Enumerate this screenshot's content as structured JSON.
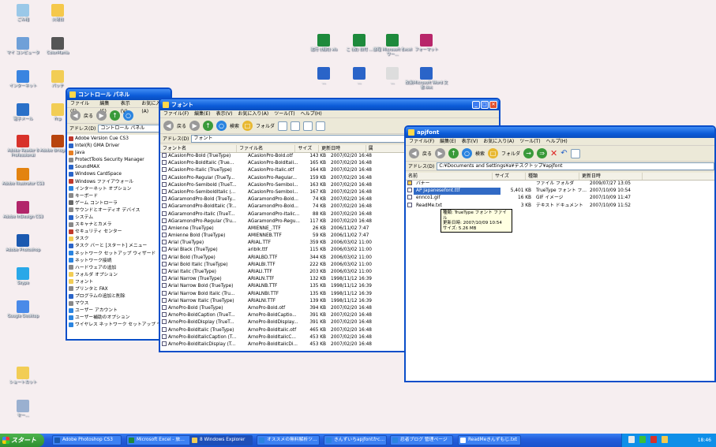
{
  "desktop_icons": [
    {
      "label": "ごみ箱",
      "color": "#9ac8e8"
    },
    {
      "label": "火曜日",
      "color": "#f5c84a"
    },
    {
      "label": "マイ コンピュータ",
      "color": "#6fa0d8"
    },
    {
      "label": "ColorMania",
      "color": "#555555"
    },
    {
      "label": "インターネット",
      "color": "#3a84e0"
    },
    {
      "label": "パッチ",
      "color": "#f2cd55"
    },
    {
      "label": "電子メール",
      "color": "#2a70c8"
    },
    {
      "label": "Fr.p",
      "color": "#f2cd55"
    },
    {
      "label": "Adobe Reader 8 Professional",
      "color": "#d8322a"
    },
    {
      "label": "Adobe Bridge CS3",
      "color": "#b8440e"
    },
    {
      "label": "Adobe Illustrator CS3",
      "color": "#e38310"
    },
    {
      "label": "Adobe InDesign CS3",
      "color": "#b2266a"
    },
    {
      "label": "Adobe Photoshop",
      "color": "#1b59b0"
    },
    {
      "label": "Skype",
      "color": "#29a8e8"
    },
    {
      "label": "Google Desktop",
      "color": "#4a8ae8"
    },
    {
      "label": "ショートカット",
      "color": "#f2cd55"
    },
    {
      "label": "セー…",
      "color": "#9ab0d0"
    }
  ],
  "right_icons": [
    {
      "label": "進行 (規約) xls",
      "color": "#1e8a3c"
    },
    {
      "label": "こ (改) 日付 …",
      "color": "#1e8a3c"
    },
    {
      "label": "旅程 Microsoft Excel ワー…",
      "color": "#1e8a3c"
    },
    {
      "label": "フォーマット",
      "color": "#b8266a"
    },
    {
      "label": "…",
      "color": "#2a64c8"
    },
    {
      "label": "…",
      "color": "#2a64c8"
    },
    {
      "label": "…",
      "color": "#dddddd"
    },
    {
      "label": "改良Microsoft Word 文書.doc",
      "color": "#2a64c8"
    }
  ],
  "control_panel": {
    "title": "コントロール パネル",
    "menu": [
      "ファイル(F)",
      "編集(E)",
      "表示(V)",
      "お気に入り(A)"
    ],
    "back": "戻る",
    "address_label": "アドレス(D)",
    "address": "コントロール パネル",
    "items": [
      {
        "label": "Adobe Version Cue CS3",
        "color": "#c0392b"
      },
      {
        "label": "Intel(R) GMA Driver",
        "color": "#2a64c8"
      },
      {
        "label": "Java",
        "color": "#e67e22"
      },
      {
        "label": "ProtectTools Security Manager",
        "color": "#888888"
      },
      {
        "label": "SoundMAX",
        "color": "#2a64c8"
      },
      {
        "label": "Windows CardSpace",
        "color": "#2a64c8"
      },
      {
        "label": "Windows ファイアウォール",
        "color": "#c0392b"
      },
      {
        "label": "インターネット オプション",
        "color": "#2a84e0"
      },
      {
        "label": "キーボード",
        "color": "#888888"
      },
      {
        "label": "ゲーム コントローラ",
        "color": "#666666"
      },
      {
        "label": "サウンドとオーディオ デバイス",
        "color": "#888888"
      },
      {
        "label": "システム",
        "color": "#2a64c8"
      },
      {
        "label": "スキャナとカメラ",
        "color": "#888888"
      },
      {
        "label": "セキュリティ センター",
        "color": "#c0392b"
      },
      {
        "label": "タスク",
        "color": "#f2cd55"
      },
      {
        "label": "タスク バーと [スタート] メニュー",
        "color": "#2a64c8"
      },
      {
        "label": "ネットワーク セットアップ ウィザード",
        "color": "#2a84e0"
      },
      {
        "label": "ネットワーク接続",
        "color": "#2a84e0"
      },
      {
        "label": "ハードウェアの追加",
        "color": "#888888"
      },
      {
        "label": "フォルダ オプション",
        "color": "#f2cd55"
      },
      {
        "label": "フォント",
        "color": "#f2cd55"
      },
      {
        "label": "プリンタと FAX",
        "color": "#888888"
      },
      {
        "label": "プログラムの追加と削除",
        "color": "#2a64c8"
      },
      {
        "label": "マウス",
        "color": "#888888"
      },
      {
        "label": "ユーザー アカウント",
        "color": "#2a84e0"
      },
      {
        "label": "ユーザー補助のオプション",
        "color": "#2a84e0"
      },
      {
        "label": "ワイヤレス ネットワーク セットアップ ウィザード",
        "color": "#2a84e0"
      }
    ]
  },
  "fonts_window": {
    "title": "フォント",
    "menu": [
      "ファイル(F)",
      "編集(E)",
      "表示(V)",
      "お気に入り(A)",
      "ツール(T)",
      "ヘルプ(H)"
    ],
    "back": "戻る",
    "search": "検索",
    "folder": "フォルダ",
    "address_label": "アドレス(D)",
    "address": "フォント",
    "columns": [
      "フォント名",
      "ファイル名",
      "サイズ",
      "更新日時",
      "属"
    ],
    "rows": [
      [
        "ACaslonPro-Bold (TrueType)",
        "ACaslonPro-Bold.otf",
        "143 KB",
        "2007/02/20 16:48"
      ],
      [
        "ACaslonPro-BoldItalic (True...",
        "ACaslonPro-BoldItali...",
        "165 KB",
        "2007/02/20 16:48"
      ],
      [
        "ACaslonPro-Italic (TrueType)",
        "ACaslonPro-Italic.otf",
        "164 KB",
        "2007/02/20 16:48"
      ],
      [
        "ACaslonPro-Regular (TrueTy...",
        "ACaslonPro-Regular...",
        "159 KB",
        "2007/02/20 16:48"
      ],
      [
        "ACaslonPro-Semibold (TrueT...",
        "ACaslonPro-Semibol...",
        "163 KB",
        "2007/02/20 16:48"
      ],
      [
        "ACaslonPro-SemiboldItalic (...",
        "ACaslonPro-Semibol...",
        "167 KB",
        "2007/02/20 16:48"
      ],
      [
        "AGaramondPro-Bold (TrueTy...",
        "AGaramondPro-Bold...",
        "74 KB",
        "2007/02/20 16:48"
      ],
      [
        "AGaramondPro-BoldItalic (Tr...",
        "AGaramondPro-Bold...",
        "74 KB",
        "2007/02/20 16:48"
      ],
      [
        "AGaramondPro-Italic (TrueT...",
        "AGaramondPro-Italic...",
        "88 KB",
        "2007/02/20 16:48"
      ],
      [
        "AGaramondPro-Regular (Tru...",
        "AGaramondPro-Regu...",
        "117 KB",
        "2007/02/20 16:48"
      ],
      [
        "Amienne (TrueType)",
        "AMIENNE_.TTF",
        "26 KB",
        "2006/11/02 7:47"
      ],
      [
        "Amienne Bold (TrueType)",
        "AMIENNEB.TTF",
        "59 KB",
        "2006/11/02 7:47"
      ],
      [
        "Arial (TrueType)",
        "ARIAL.TTF",
        "359 KB",
        "2006/03/02 11:00"
      ],
      [
        "Arial Black (TrueType)",
        "ariblk.ttf",
        "115 KB",
        "2006/03/02 11:00"
      ],
      [
        "Arial Bold (TrueType)",
        "ARIALBD.TTF",
        "344 KB",
        "2006/03/02 11:00"
      ],
      [
        "Arial Bold Italic (TrueType)",
        "ARIALBI.TTF",
        "222 KB",
        "2006/03/02 11:00"
      ],
      [
        "Arial Italic (TrueType)",
        "ARIALI.TTF",
        "203 KB",
        "2006/03/02 11:00"
      ],
      [
        "Arial Narrow (TrueType)",
        "ARIALN.TTF",
        "132 KB",
        "1998/11/12 16:39"
      ],
      [
        "Arial Narrow Bold (TrueType)",
        "ARIALNB.TTF",
        "135 KB",
        "1998/11/12 16:39"
      ],
      [
        "Arial Narrow Bold Italic (Tru...",
        "ARIALNBI.TTF",
        "135 KB",
        "1998/11/12 16:39"
      ],
      [
        "Arial Narrow Italic (TrueType)",
        "ARIALNI.TTF",
        "139 KB",
        "1998/11/12 16:39"
      ],
      [
        "ArnoPro-Bold (TrueType)",
        "ArnoPro-Bold.otf",
        "394 KB",
        "2007/02/20 16:48"
      ],
      [
        "ArnoPro-BoldCaption (TrueT...",
        "ArnoPro-BoldCaptio...",
        "391 KB",
        "2007/02/20 16:48"
      ],
      [
        "ArnoPro-BoldDisplay (TrueT...",
        "ArnoPro-BoldDisplay...",
        "391 KB",
        "2007/02/20 16:48"
      ],
      [
        "ArnoPro-BoldItalic (TrueType)",
        "ArnoPro-BoldItalic.otf",
        "465 KB",
        "2007/02/20 16:48"
      ],
      [
        "ArnoPro-BoldItalicCaption (T...",
        "ArnoPro-BoldItalicC...",
        "453 KB",
        "2007/02/20 16:48"
      ],
      [
        "ArnoPro-BoldItalicDisplay (T...",
        "ArnoPro-BoldItalicDi...",
        "453 KB",
        "2007/02/20 16:48"
      ]
    ]
  },
  "apjfont_window": {
    "title": "apjfont",
    "menu": [
      "ファイル(F)",
      "編集(E)",
      "表示(V)",
      "お気に入り(A)",
      "ツール(T)",
      "ヘルプ(H)"
    ],
    "back": "戻る",
    "search": "検索",
    "folder": "フォルダ",
    "address_label": "アドレス(D)",
    "address": "C:¥Documents and Settings¥a¥デスクトップ¥apjfont",
    "columns": [
      "名前",
      "サイズ",
      "種類",
      "更新日時"
    ],
    "rows": [
      [
        "バナー",
        "",
        "ファイル フォルダ",
        "2009/07/27 13:05"
      ],
      [
        "AP Japanesefont.ttf",
        "5,401 KB",
        "TrueType フォント フ…",
        "2007/10/09 10:54"
      ],
      [
        "ennco1.gif",
        "16 KB",
        "GIF イメージ",
        "2007/10/09 11:47"
      ],
      [
        "ReadMe.txt",
        "3 KB",
        "テキスト ドキュメント",
        "2007/10/09 11:52"
      ]
    ],
    "tooltip": [
      "種類: TrueType フォント ファイル",
      "更新日時: 2007/10/09 10:54",
      "サイズ: 5.26 MB"
    ]
  },
  "taskbar": {
    "start": "スタート",
    "tasks": [
      {
        "label": "Adobe Photoshop CS3",
        "color": "#1b59b0"
      },
      {
        "label": "Microsoft Excel - 旅…",
        "color": "#1e8a3c"
      },
      {
        "label": "8 Windows Explorer",
        "color": "#f2cd55"
      },
      {
        "label": "オススメの無料解析ツ…",
        "color": "#2a84e0"
      },
      {
        "label": "きんずいちapjfontかc…",
        "color": "#2a84e0"
      },
      {
        "label": "忍者ブログ 管理ページ",
        "color": "#2a84e0"
      },
      {
        "label": "ReadMeきんずもじ.txt",
        "color": "#ffffff"
      }
    ],
    "clock": "18:46"
  }
}
